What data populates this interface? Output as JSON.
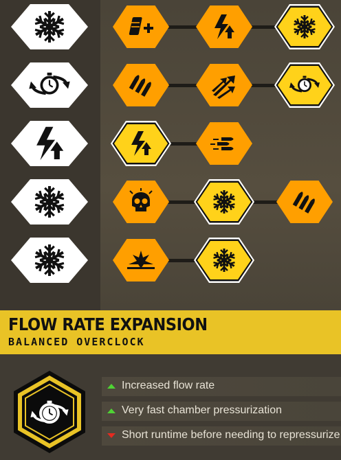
{
  "colors": {
    "accent_yellow": "#e9c326",
    "mod_orange": "#ff9f00",
    "mod_selected": "#ffd21a",
    "positive": "#4fd334",
    "negative": "#e52a20",
    "icon_dark": "#111111"
  },
  "tiers": [
    {
      "tier_icon": "snowflake-icon",
      "mods": [
        {
          "icon": "ammo-plus-icon",
          "selected": false
        },
        {
          "icon": "lightning-boost-icon",
          "selected": false
        },
        {
          "icon": "snowflake-icon",
          "selected": true
        }
      ]
    },
    {
      "tier_icon": "stopwatch-cycle-icon",
      "mods": [
        {
          "icon": "bullets-icon",
          "selected": false
        },
        {
          "icon": "arrows-spread-icon",
          "selected": false
        },
        {
          "icon": "stopwatch-cycle-icon",
          "selected": true
        }
      ]
    },
    {
      "tier_icon": "lightning-boost-icon",
      "mods": [
        {
          "icon": "lightning-boost-icon",
          "selected": true
        },
        {
          "icon": "bullets-fast-icon",
          "selected": false
        }
      ]
    },
    {
      "tier_icon": "snowflake-icon",
      "mods": [
        {
          "icon": "skull-icon",
          "selected": false
        },
        {
          "icon": "snowflake-icon",
          "selected": true
        },
        {
          "icon": "bullets-icon",
          "selected": false
        }
      ]
    },
    {
      "tier_icon": "snowflake-icon",
      "mods": [
        {
          "icon": "explosion-icon",
          "selected": false
        },
        {
          "icon": "snowflake-icon",
          "selected": true
        }
      ]
    }
  ],
  "overclock": {
    "title": "FLOW RATE EXPANSION",
    "subtitle": "BALANCED OVERCLOCK",
    "badge_icon": "stopwatch-cycle-icon",
    "effects": [
      {
        "text": "Increased flow rate",
        "type": "positive"
      },
      {
        "text": "Very fast chamber pressurization",
        "type": "positive"
      },
      {
        "text": "Short runtime before needing to repressurize",
        "type": "negative"
      }
    ]
  }
}
